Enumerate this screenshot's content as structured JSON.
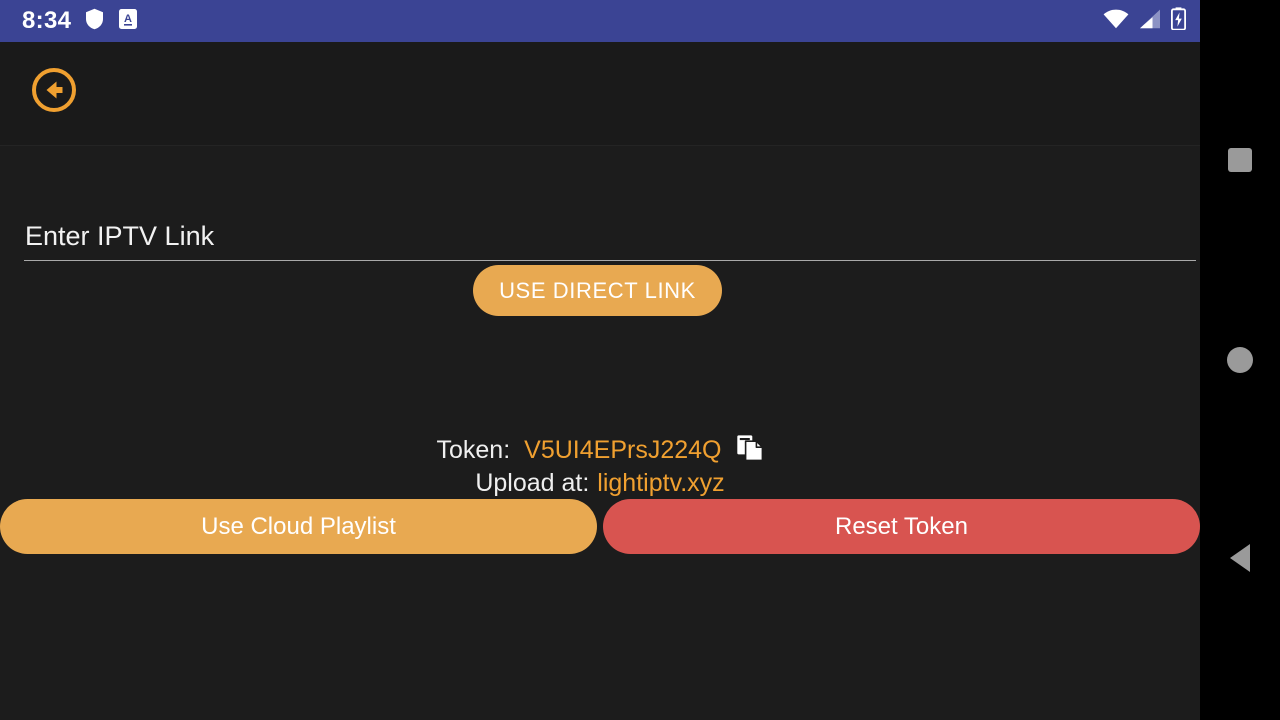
{
  "statusbar": {
    "time": "8:34",
    "left_icons": [
      "shield-icon",
      "letter-a-badge-icon"
    ],
    "right_icons": [
      "wifi-icon",
      "cellular-signal-icon",
      "battery-charging-icon"
    ],
    "background_color": "#3b4494",
    "foreground_color": "#ffffff"
  },
  "appbar": {
    "back_icon": "back-arrow-circle-icon",
    "accent_color": "#f0a030"
  },
  "form": {
    "link_input_placeholder": "Enter IPTV Link",
    "link_input_value": "",
    "direct_link_button_label": "USE DIRECT LINK"
  },
  "token": {
    "label": "Token:",
    "value": "V5UI4EPrsJ224Q",
    "copy_icon": "copy-icon",
    "upload_label": "Upload at:",
    "upload_link": "lightiptv.xyz"
  },
  "actions": {
    "cloud_playlist_label": "Use Cloud Playlist",
    "reset_token_label": "Reset Token"
  },
  "navbar": {
    "recents": "square-recents-icon",
    "home": "circle-home-icon",
    "back": "triangle-back-icon"
  },
  "colors": {
    "accent_orange": "#e8a951",
    "token_orange": "#f0a030",
    "danger_red": "#d85450",
    "app_background": "#1c1c1c",
    "appbar_background": "#1a1a1a",
    "navbar_background": "#000000"
  }
}
